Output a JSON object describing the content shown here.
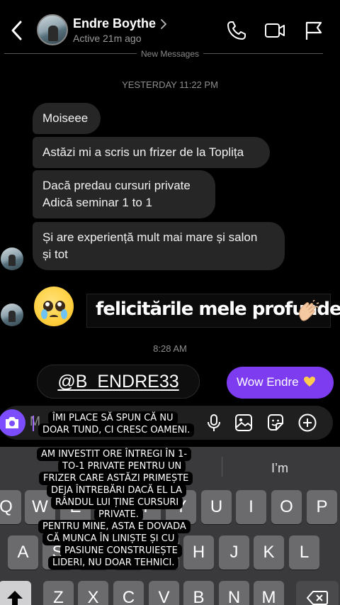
{
  "header": {
    "contact_name": "Endre Boythe",
    "status": "Active 21m ago",
    "icons": [
      "back-chevron",
      "avatar",
      "chevron-right",
      "phone",
      "video-camera",
      "flag"
    ]
  },
  "conversation": {
    "new_messages_label": "New Messages",
    "timestamp_1": "YESTERDAY 11:22 PM",
    "messages": [
      {
        "text": "Moiseee"
      },
      {
        "text": "Astăzi mi a scris un frizer de la Toplița"
      },
      {
        "text": "Dacă predau cursuri private\nAdică seminar 1 to 1"
      },
      {
        "text": "Și are experiență mult mai mare și salon\nși tot"
      }
    ],
    "emoji": "face-holding-back-tears",
    "sticker_text": "felicitările mele profunde",
    "timestamp_2": "8:28 AM",
    "mention": "@B_ENDRE33",
    "sent_message": "Wow Endre"
  },
  "composer": {
    "placeholder": "M",
    "icons": [
      "camera",
      "microphone",
      "gallery",
      "sticker",
      "plus"
    ]
  },
  "keyboard": {
    "suggestion": "I’m",
    "row1": [
      "Q",
      "W",
      "E",
      "R",
      "T",
      "Y",
      "U",
      "I",
      "O",
      "P"
    ],
    "row2": [
      "A",
      "S",
      "D",
      "F",
      "G",
      "H",
      "J",
      "K",
      "L"
    ],
    "row3": [
      "Z",
      "X",
      "C",
      "V",
      "B",
      "N",
      "M"
    ]
  },
  "overlay_caption": [
    "ÎMI PLACE SĂ SPUN CĂ NU",
    "DOAR TUND, CI CRESC OAMENI.",
    "AM INVESTIT ORE ÎNTREGI ÎN 1-",
    "TO-1 PRIVATE PENTRU UN",
    "FRIZER CARE ASTĂZI PRIMEȘTE",
    "DEJA ÎNTREBĂRI DACĂ EL LA",
    "RÂNDUL LUI ȚINE CURSURI",
    "PRIVATE.",
    "PENTRU MINE, ASTA E DOVADA",
    "CĂ MUNCA ÎN LINIȘTE ȘI CU",
    "PASIUNE CONSTRUIEȘTE",
    "LIDERI, NU DOAR TEHNICI."
  ],
  "colors": {
    "background": "#000000",
    "received_bubble": "#262626",
    "sent_bubble": "#7d3cf0",
    "keyboard": "#3a3a3c"
  }
}
